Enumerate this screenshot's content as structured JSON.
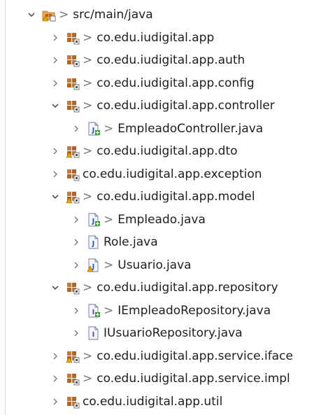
{
  "tree": {
    "items": [
      {
        "label": "src/main/java",
        "dirty": true,
        "expanded": true,
        "kind": "source-folder",
        "level": 0
      },
      {
        "label": "co.edu.iudigital.app",
        "dirty": true,
        "expanded": false,
        "kind": "package",
        "level": 1
      },
      {
        "label": "co.edu.iudigital.app.auth",
        "dirty": true,
        "expanded": false,
        "kind": "package",
        "level": 1
      },
      {
        "label": "co.edu.iudigital.app.config",
        "dirty": true,
        "expanded": false,
        "kind": "package",
        "level": 1
      },
      {
        "label": "co.edu.iudigital.app.controller",
        "dirty": true,
        "expanded": true,
        "kind": "package",
        "level": 1
      },
      {
        "label": "EmpleadoController.java",
        "dirty": true,
        "expanded": false,
        "kind": "java-file-added",
        "level": 2
      },
      {
        "label": "co.edu.iudigital.app.dto",
        "dirty": true,
        "expanded": false,
        "kind": "package-warning",
        "level": 1
      },
      {
        "label": "co.edu.iudigital.app.exception",
        "dirty": false,
        "expanded": false,
        "kind": "package",
        "level": 1
      },
      {
        "label": "co.edu.iudigital.app.model",
        "dirty": true,
        "expanded": true,
        "kind": "package-warning",
        "level": 1
      },
      {
        "label": "Empleado.java",
        "dirty": true,
        "expanded": false,
        "kind": "java-file-added",
        "level": 2
      },
      {
        "label": "Role.java",
        "dirty": false,
        "expanded": false,
        "kind": "java-file",
        "level": 2
      },
      {
        "label": "Usuario.java",
        "dirty": true,
        "expanded": false,
        "kind": "java-file-warning",
        "level": 2
      },
      {
        "label": "co.edu.iudigital.app.repository",
        "dirty": true,
        "expanded": true,
        "kind": "package",
        "level": 1
      },
      {
        "label": "IEmpleadoRepository.java",
        "dirty": true,
        "expanded": false,
        "kind": "interface-file-added",
        "level": 2
      },
      {
        "label": "IUsuarioRepository.java",
        "dirty": false,
        "expanded": false,
        "kind": "interface-file",
        "level": 2
      },
      {
        "label": "co.edu.iudigital.app.service.iface",
        "dirty": true,
        "expanded": false,
        "kind": "package-warning",
        "level": 1
      },
      {
        "label": "co.edu.iudigital.app.service.impl",
        "dirty": true,
        "expanded": false,
        "kind": "package",
        "level": 1
      },
      {
        "label": "co.edu.iudigital.app.util",
        "dirty": false,
        "expanded": false,
        "kind": "package",
        "level": 1
      }
    ],
    "dirty_marker": ">",
    "icons": {
      "source-folder": "source-folder-icon",
      "package": "package-icon",
      "package-warning": "package-warning-icon",
      "java-file": "java-file-icon",
      "java-file-added": "java-file-added-icon",
      "java-file-warning": "java-file-warning-icon",
      "interface-file": "interface-file-icon",
      "interface-file-added": "interface-file-added-icon"
    },
    "colors": {
      "package": "#b5651d",
      "warning": "#e8a500",
      "added": "#3c9d35",
      "interface": "#6a3fb5",
      "git": "#f0a44b"
    }
  }
}
